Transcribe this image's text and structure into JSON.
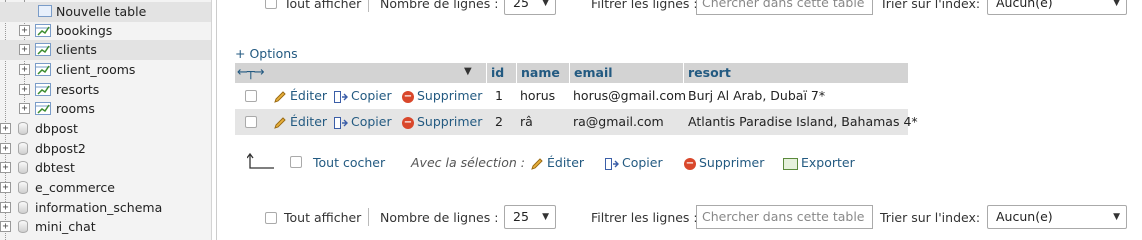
{
  "sidebar": {
    "new_table": "Nouvelle table",
    "tables": [
      "bookings",
      "clients",
      "client_rooms",
      "resorts",
      "rooms"
    ],
    "databases": [
      "dbpost",
      "dbpost2",
      "dbtest",
      "e_commerce",
      "information_schema",
      "mini_chat"
    ]
  },
  "top_bar": {
    "show_all": "Tout afficher",
    "rows_label": "Nombre de lignes :",
    "rows_value": "25",
    "filter_label": "Filtrer les lignes :",
    "filter_placeholder": "Chercher dans cette table",
    "sort_label": "Trier sur l'index:",
    "sort_value": "Aucun(e)"
  },
  "options_link": "+ Options",
  "table": {
    "columns": [
      "id",
      "name",
      "email",
      "resort"
    ],
    "rows": [
      {
        "id": "1",
        "name": "horus",
        "email": "horus@gmail.com",
        "resort": "Burj Al Arab, Dubaï 7*"
      },
      {
        "id": "2",
        "name": "râ",
        "email": "ra@gmail.com",
        "resort": "Atlantis Paradise Island, Bahamas 4*"
      }
    ],
    "row_actions": {
      "edit": "Éditer",
      "copy": "Copier",
      "delete": "Supprimer"
    }
  },
  "bulk": {
    "check_all": "Tout cocher",
    "with_selection": "Avec la sélection :",
    "edit": "Éditer",
    "copy": "Copier",
    "delete": "Supprimer",
    "export": "Exporter"
  },
  "bottom_bar": {
    "show_all": "Tout afficher",
    "rows_label": "Nombre de lignes :",
    "rows_value": "25",
    "filter_label": "Filtrer les lignes :",
    "filter_placeholder": "Chercher dans cette table",
    "sort_label": "Trier sur l'index:",
    "sort_value": "Aucun(e)"
  },
  "colors": {
    "link": "#235a81",
    "header_bg": "#d3d3d3",
    "row_alt": "#e5e5e5",
    "delete_red": "#d9472b"
  }
}
